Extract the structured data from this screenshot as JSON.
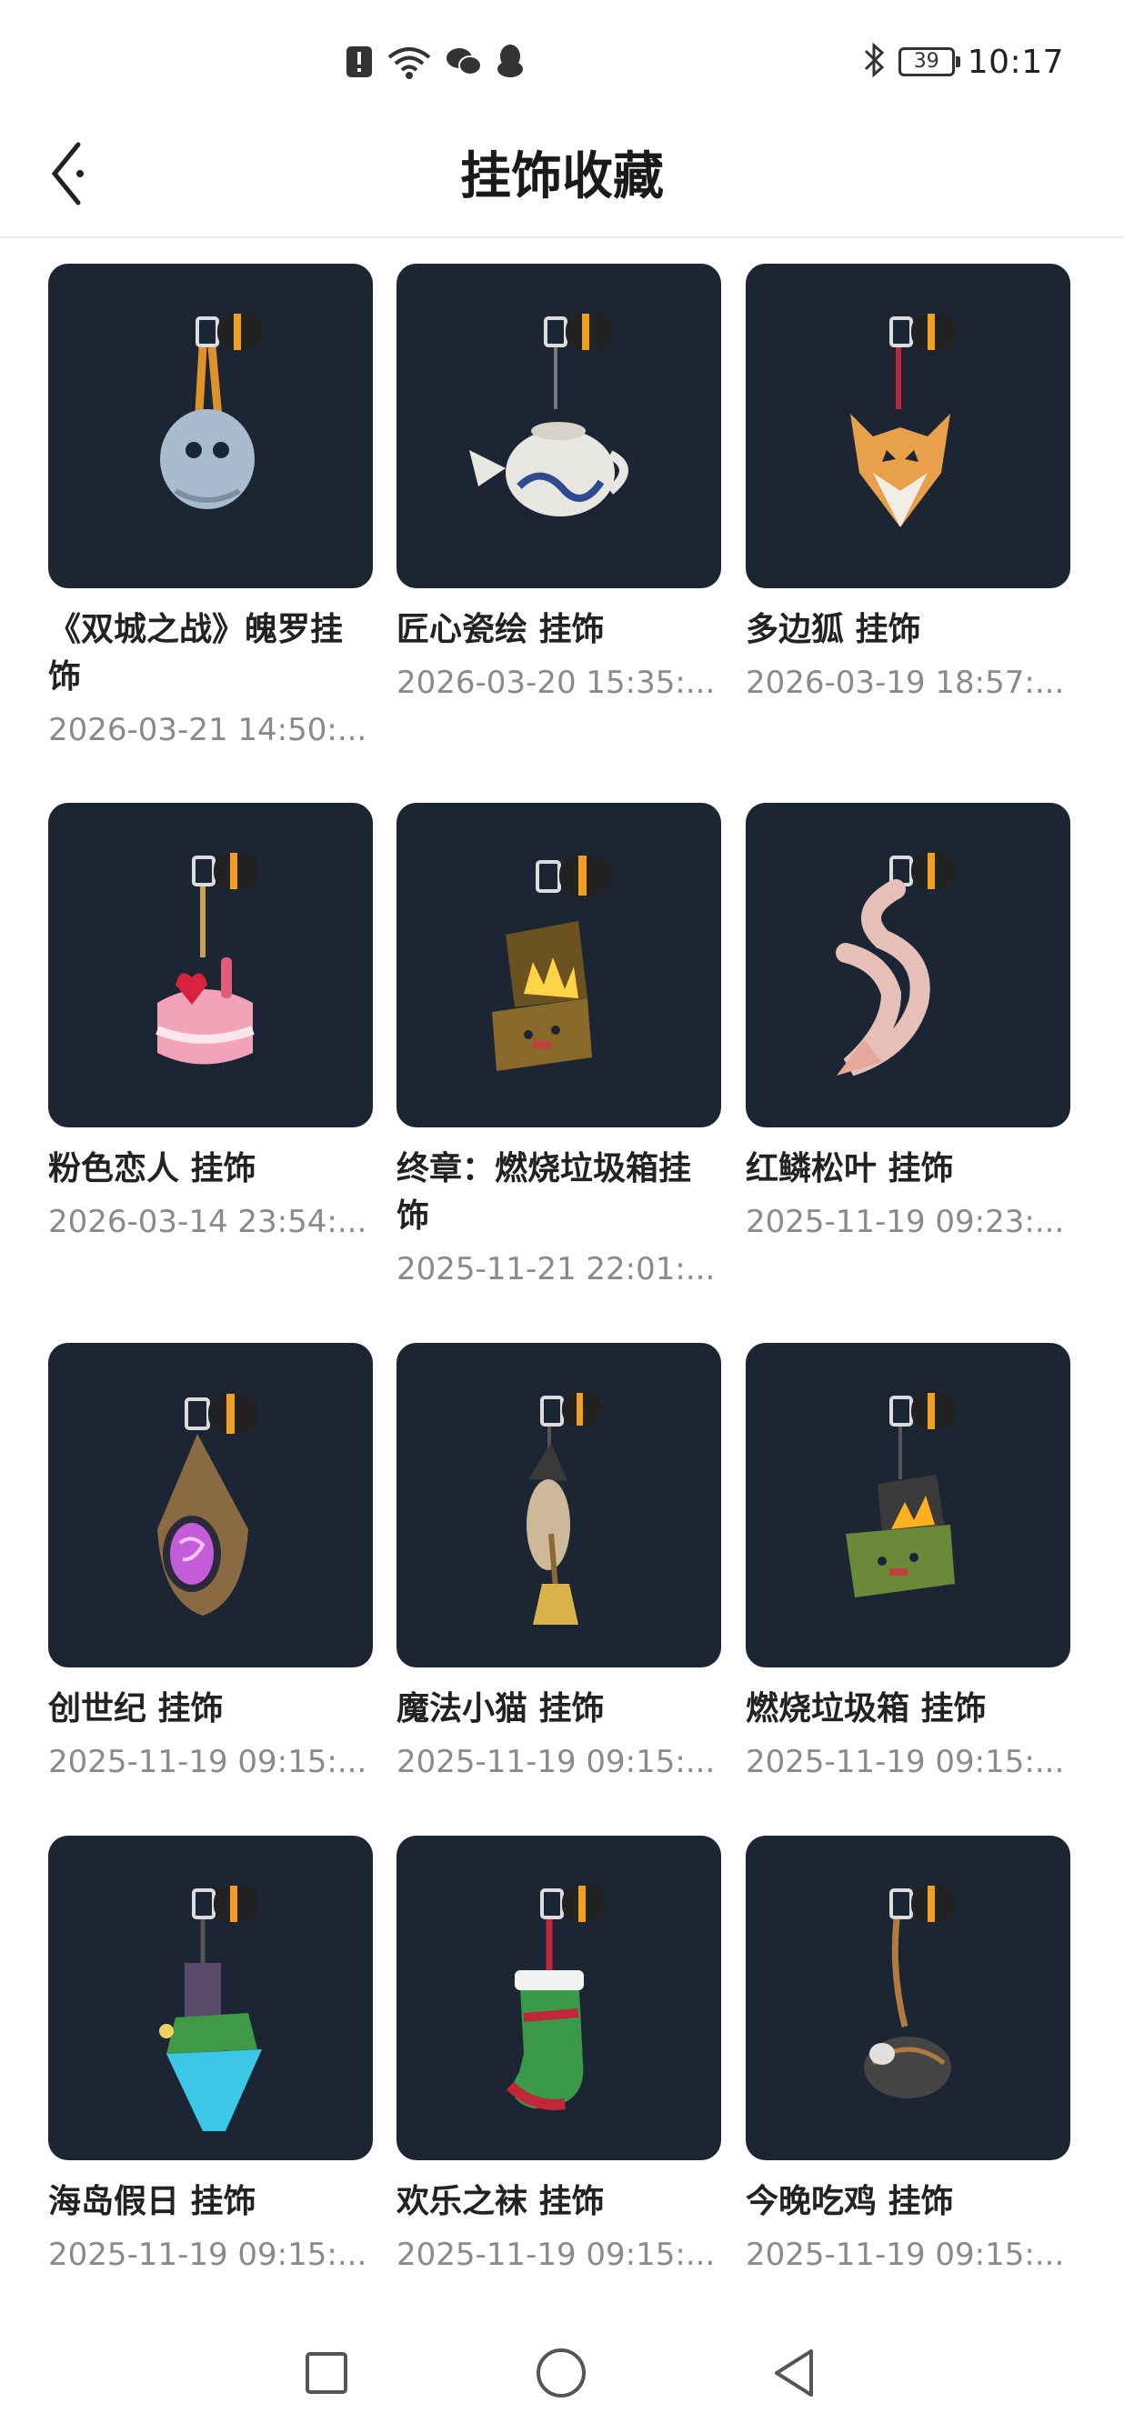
{
  "status_bar": {
    "battery": "39",
    "time": "10:17",
    "icons": [
      "alert-icon",
      "wifi-icon",
      "wechat-icon",
      "qq-icon",
      "bluetooth-icon",
      "battery-icon"
    ]
  },
  "header": {
    "title": "挂饰收藏",
    "back_icon": "back-arrow-icon"
  },
  "items": [
    {
      "name": "《双城之战》魄罗挂饰",
      "date": "2026-03-21 14:50:..."
    },
    {
      "name": "匠心瓷绘 挂饰",
      "date": "2026-03-20 15:35:..."
    },
    {
      "name": "多边狐 挂饰",
      "date": "2026-03-19 18:57:..."
    },
    {
      "name": "粉色恋人 挂饰",
      "date": "2026-03-14 23:54:..."
    },
    {
      "name": "终章：燃烧垃圾箱挂饰",
      "date": "2025-11-21 22:01:..."
    },
    {
      "name": "红鳞松叶 挂饰",
      "date": "2025-11-19 09:23:..."
    },
    {
      "name": "创世纪 挂饰",
      "date": "2025-11-19 09:15:..."
    },
    {
      "name": "魔法小猫 挂饰",
      "date": "2025-11-19 09:15:..."
    },
    {
      "name": "燃烧垃圾箱 挂饰",
      "date": "2025-11-19 09:15:..."
    },
    {
      "name": "海岛假日 挂饰",
      "date": "2025-11-19 09:15:..."
    },
    {
      "name": "欢乐之袜 挂饰",
      "date": "2025-11-19 09:15:..."
    },
    {
      "name": "今晚吃鸡 挂饰",
      "date": "2025-11-19 09:15:..."
    }
  ],
  "nav": {
    "icons": [
      "recent-apps-icon",
      "home-icon",
      "back-icon"
    ]
  },
  "colors": {
    "thumb_bg": "#1c2533",
    "accent_orange": "#f0a020",
    "date_gray": "#8a8a8a"
  }
}
